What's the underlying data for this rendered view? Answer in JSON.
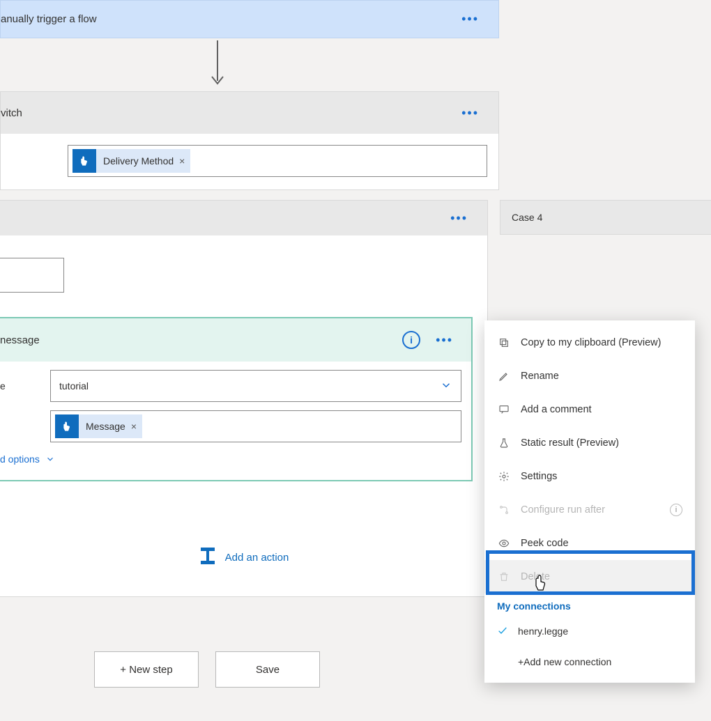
{
  "trigger": {
    "title": "anually trigger a flow"
  },
  "switch": {
    "title": "vitch",
    "token": {
      "label": "Delivery Method"
    }
  },
  "case_left": {
    "message_card": {
      "title": "nessage",
      "row_label": "e",
      "select_value": "tutorial",
      "token": "Message",
      "advanced": "d options"
    },
    "add_action": "Add an action"
  },
  "case4": {
    "title": "Case 4"
  },
  "buttons": {
    "new_step": "+ New step",
    "save": "Save"
  },
  "menu": {
    "copy": "Copy to my clipboard (Preview)",
    "rename": "Rename",
    "comment": "Add a comment",
    "static_result": "Static result (Preview)",
    "settings": "Settings",
    "configure_run_after": "Configure run after",
    "peek_code": "Peek code",
    "delete": "Delete",
    "section": "My connections",
    "connection": "henry.legge",
    "add_connection": "+Add new connection"
  }
}
